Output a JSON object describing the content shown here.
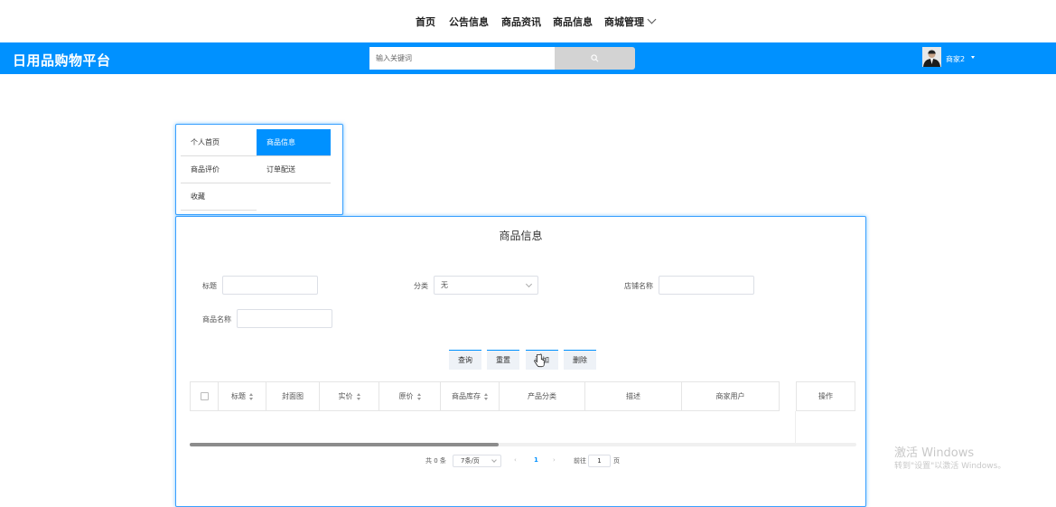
{
  "topnav": {
    "items": [
      "首页",
      "公告信息",
      "商品资讯",
      "商品信息",
      "商城管理"
    ]
  },
  "header": {
    "brand": "日用品购物平台",
    "search_placeholder": "输入关键词",
    "user_name": "商家2",
    "accent_color": "#0091ff"
  },
  "side_menu": {
    "items": [
      "个人首页",
      "商品信息",
      "商品评价",
      "订单配送",
      "收藏"
    ],
    "active": "商品信息"
  },
  "main": {
    "title": "商品信息",
    "filters": {
      "title_label": "标题",
      "category_label": "分类",
      "category_value": "无",
      "shop_label": "店铺名称",
      "merchant_label": "商品名称"
    },
    "buttons": [
      "查询",
      "重置",
      "添加",
      "删除"
    ],
    "table_headers": [
      "标题",
      "封面图",
      "实价",
      "原价",
      "商品库存",
      "产品分类",
      "描述",
      "商家用户",
      "操作"
    ]
  },
  "pagination": {
    "total": "共 0 条",
    "page_size": "7条/页",
    "current_page": "1",
    "goto_label": "前往",
    "goto_value": "1",
    "page_unit": "页"
  },
  "watermark": {
    "line1": "激活 Windows",
    "line2": "转到\"设置\"以激活 Windows。"
  }
}
